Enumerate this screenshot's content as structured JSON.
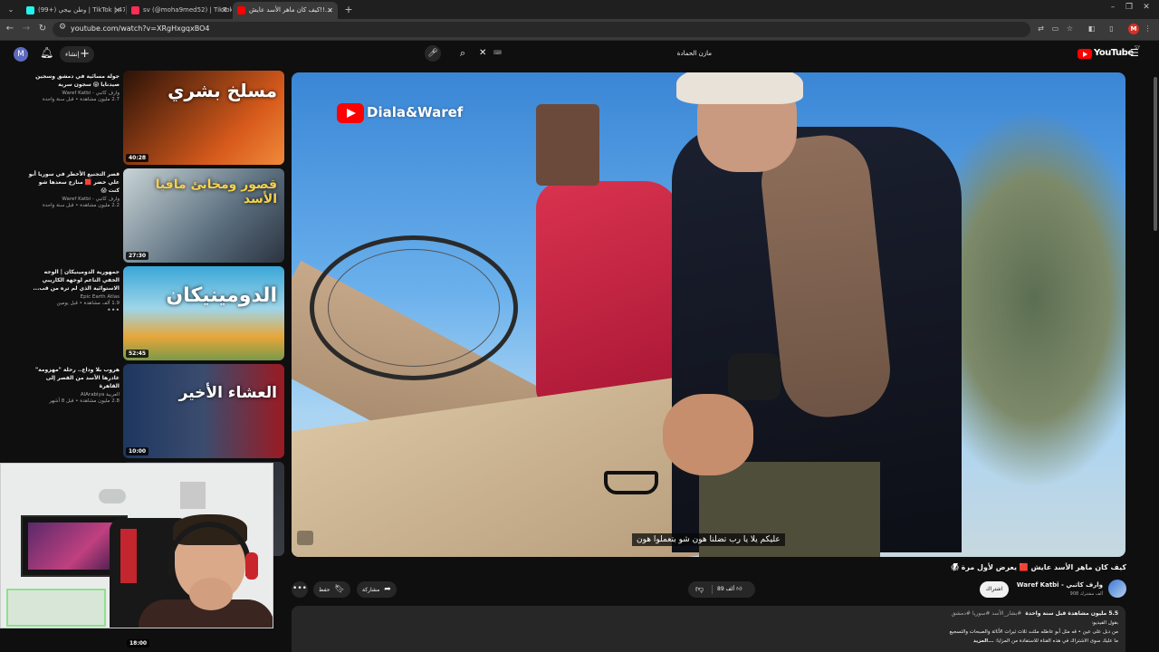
{
  "browser": {
    "tabs": [
      {
        "label": "(99+) وطن بيجي | TikTok | 476",
        "favicon_color": "#25f4ee",
        "active": false
      },
      {
        "label": "sv (@moha9med52) | TikTok",
        "favicon_color": "#fe2c55",
        "active": false
      },
      {
        "label": "كيف كان ماهر الأسد عايش!!...",
        "favicon_color": "#ff0000",
        "active": true
      }
    ],
    "new_tab": "+",
    "url": "youtube.com/watch?v=XRgHxgqxBO4",
    "profile_initial": "M"
  },
  "masthead": {
    "avatar_initial": "M",
    "create_label": "إنشاء",
    "search_value": "مازن الحمادة",
    "search_kbd": "⌨",
    "logo_text": "YouTube",
    "logo_country": "SY"
  },
  "related": [
    {
      "title": "جولة مسائية في دمشق وسجين صيدنايا 😱 سجون سرية",
      "channel": "وارف كاتبي - Waref Katbi",
      "stats": "2.7 مليون مشاهدة • قبل سنة واحدة",
      "duration": "40:28",
      "overlay": "مسلخ بشري",
      "colors": [
        "#3a1a0a",
        "#d85b1c"
      ]
    },
    {
      "title": "قصر التجنيع الأخطر في سوريا أبو علي خضر 🟥 منازع سعدها شو كنت 😱",
      "channel": "وارف كاتبي - Waref Katbi",
      "stats": "2.2 مليون مشاهدة • قبل سنة واحدة",
      "duration": "27:30",
      "overlay": "قصور ومخابئ مافيا الأسد",
      "colors": [
        "#5a6e7e",
        "#c9d4d6"
      ]
    },
    {
      "title": "جمهورية الدومينيكان | الوجه الخفي الناعم لوجهة الكاريبي الاستوائية الذي لم تره من قب...",
      "channel": "Epic Earth Atlas",
      "stats": "1.9 ألف مشاهدة • قبل يومين",
      "duration": "52:45",
      "overlay": "الدومينيكان",
      "colors": [
        "#3aa6d8",
        "#e6a63a"
      ]
    },
    {
      "title": "هروب بلا وداع.. رحلة \"مهزومة\" غادرها الأسد من القصر إلى القاهرة",
      "channel": "العربية AlArabiya",
      "stats": "2.8 مليون مشاهدة • قبل 8 أشهر",
      "duration": "10:00",
      "overlay": "العشاء الأخير",
      "colors": [
        "#1e3760",
        "#9b1a22"
      ]
    },
    {
      "title": "",
      "channel": "",
      "stats": "",
      "duration": "18:00",
      "overlay": "",
      "colors": [
        "#20222a",
        "#3a3c44"
      ]
    }
  ],
  "player": {
    "watermark": "Diala&Waref",
    "subtitle": "عليكم يلا يا رب تضلنا هون شو بتعملوا هون"
  },
  "video": {
    "title": "كيف كان ماهر الأسد عايش 🟥 يعرض لأول مرة 😱",
    "channel_name": "وارف كاتبي - Waref Katbi",
    "subscribers": "908 ألف مشترك",
    "subscribe_label": "اشتراك",
    "likes": "89 ألف",
    "share_label": "مشاركة",
    "save_label": "حفظ",
    "more_label": "•••",
    "description": {
      "stats": "5.5 مليون مشاهدة  قبل سنة واحدة",
      "tags": "#بشار_الأسد #سوريا #دمشق",
      "line1": "بقول الفيديو:",
      "line2": "من دبل على عين • قه مثل أبو عاطله ملئت ثلاث ثيرات الأثاثة والصبحات والتسجيع",
      "line3": "ما عليك سوى الاشتراك في هذه القناة للاستفادة من المزايا:",
      "more": "...المزيد"
    }
  },
  "webcam": {
    "present": true
  }
}
